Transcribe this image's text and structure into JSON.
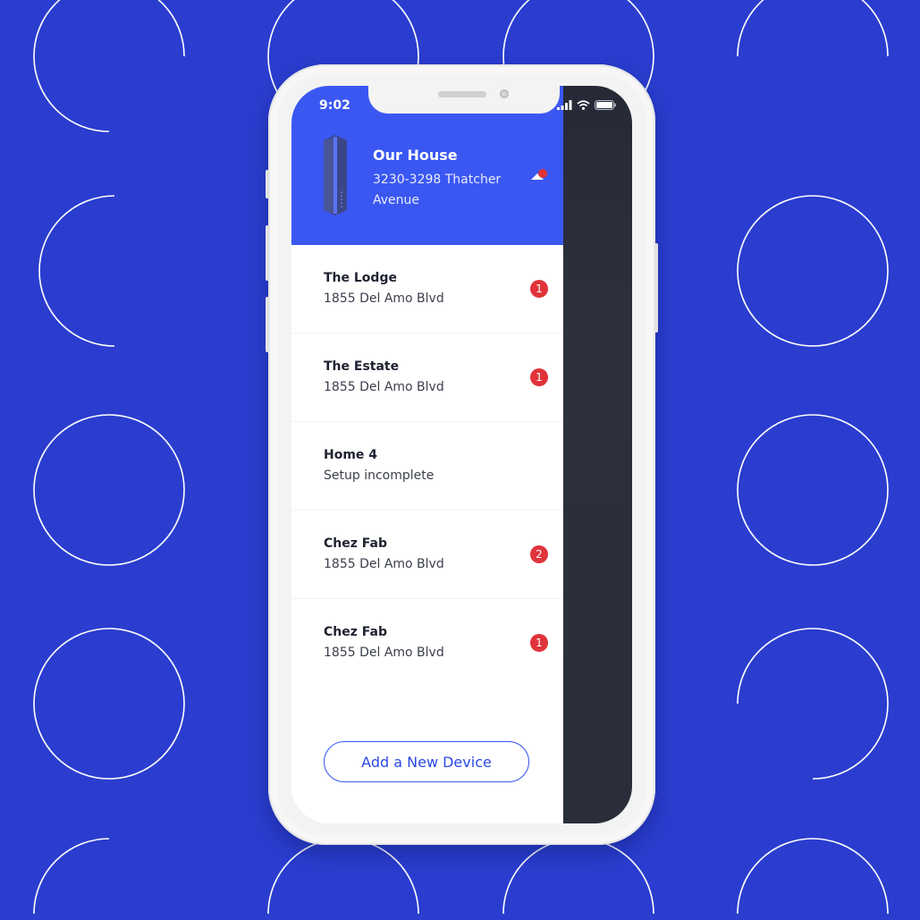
{
  "colors": {
    "background": "#2a3dcf",
    "header": "#3a57f2",
    "accent": "#2b48e6",
    "badge": "#e0333a",
    "dark_panel": "#282c38"
  },
  "status_bar": {
    "time": "9:02",
    "icons": [
      "signal-icon",
      "wifi-icon",
      "battery-icon"
    ]
  },
  "header": {
    "device_icon": "router-device-icon",
    "home_name": "Our House",
    "home_address": "3230-3298 Thatcher Avenue",
    "toggle_icon": "caret-up-icon",
    "has_notification": true
  },
  "homes": [
    {
      "name": "The Lodge",
      "subtitle": "1855 Del Amo Blvd",
      "badge": "1"
    },
    {
      "name": "The Estate",
      "subtitle": "1855 Del Amo Blvd",
      "badge": "1"
    },
    {
      "name": "Home 4",
      "subtitle": "Setup incomplete",
      "badge": null
    },
    {
      "name": "Chez Fab",
      "subtitle": "1855 Del Amo Blvd",
      "badge": "2"
    },
    {
      "name": "Chez Fab",
      "subtitle": "1855 Del Amo Blvd",
      "badge": "1"
    }
  ],
  "actions": {
    "add_device_label": "Add a New Device"
  }
}
